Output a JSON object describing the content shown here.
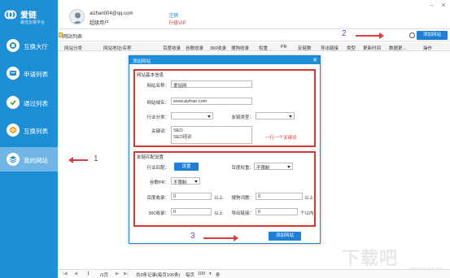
{
  "app": {
    "logo_name": "爱链",
    "logo_sub": "最佳友链平台"
  },
  "sidebar": {
    "items": [
      {
        "label": "互换大厅",
        "icon": "hall-icon"
      },
      {
        "label": "申请列表",
        "icon": "apply-list-icon"
      },
      {
        "label": "通过列表",
        "icon": "check-icon"
      },
      {
        "label": "互换列表",
        "icon": "exchange-icon"
      },
      {
        "label": "我的网站",
        "icon": "my-site-icon",
        "active": true
      }
    ]
  },
  "user": {
    "email": "aizhan004@qq.com",
    "role": "超级用户",
    "logout": "注销",
    "vip": "升级VIP"
  },
  "window": {
    "min": "–",
    "close": "✕"
  },
  "toolbar": {
    "title": "网站列表",
    "add_button": "添加网站"
  },
  "table": {
    "headers": [
      "网站分类",
      "网站地址/名称",
      "百度收录",
      "谷歌收录",
      "360收录",
      "搜狗收录",
      "权重",
      "PR",
      "反链数",
      "导出链接",
      "类型",
      "更新时间",
      "数据更...",
      "操作"
    ]
  },
  "footer": {
    "first": "|◀",
    "prev": "◀",
    "page": "1",
    "total_pages": "/1页",
    "next": "▶",
    "last": "▶|",
    "records": "共0条记录(每页100条)",
    "per_page_label": "每页",
    "per_page": "100",
    "per_page_unit": "条"
  },
  "dialog": {
    "title": "添加网站",
    "basic": {
      "title": "网站基本信息",
      "name_label": "网站名称：",
      "name_value": "爱站网",
      "domain_label": "网站域名：",
      "domain_value": "www.aizhan.com",
      "industry_label": "行业分类：",
      "link_type_label": "友链类型：",
      "keywords_label": "关键词：",
      "keyword1": "SEO",
      "keyword2": "SEO培训",
      "keyword_hint": "一行一个关键词"
    },
    "match": {
      "title": "友链匹配设置",
      "industry_match_label": "行业匹配：",
      "set_button": "设置",
      "baidu_weight_label": "百度权重：",
      "baidu_weight_value": "不限制",
      "google_pr_label": "谷歌PR：",
      "google_pr_value": "不限制",
      "baidu_index_label": "百度收录：",
      "baidu_index_value": "0",
      "above1": "以上",
      "sogou_label": "搜狗词数：",
      "sogou_value": "0",
      "above2": "以上",
      "index360_label": "360收录：",
      "index360_value": "0",
      "above3": "以上",
      "export_label": "导出链接：",
      "export_value": "0",
      "within": "个以内"
    },
    "submit": "添加网站"
  },
  "annotations": {
    "n1": "1",
    "n2": "2",
    "n3": "3"
  },
  "watermark": {
    "text": "下载吧",
    "sub": "www.xiazaiba.com"
  }
}
